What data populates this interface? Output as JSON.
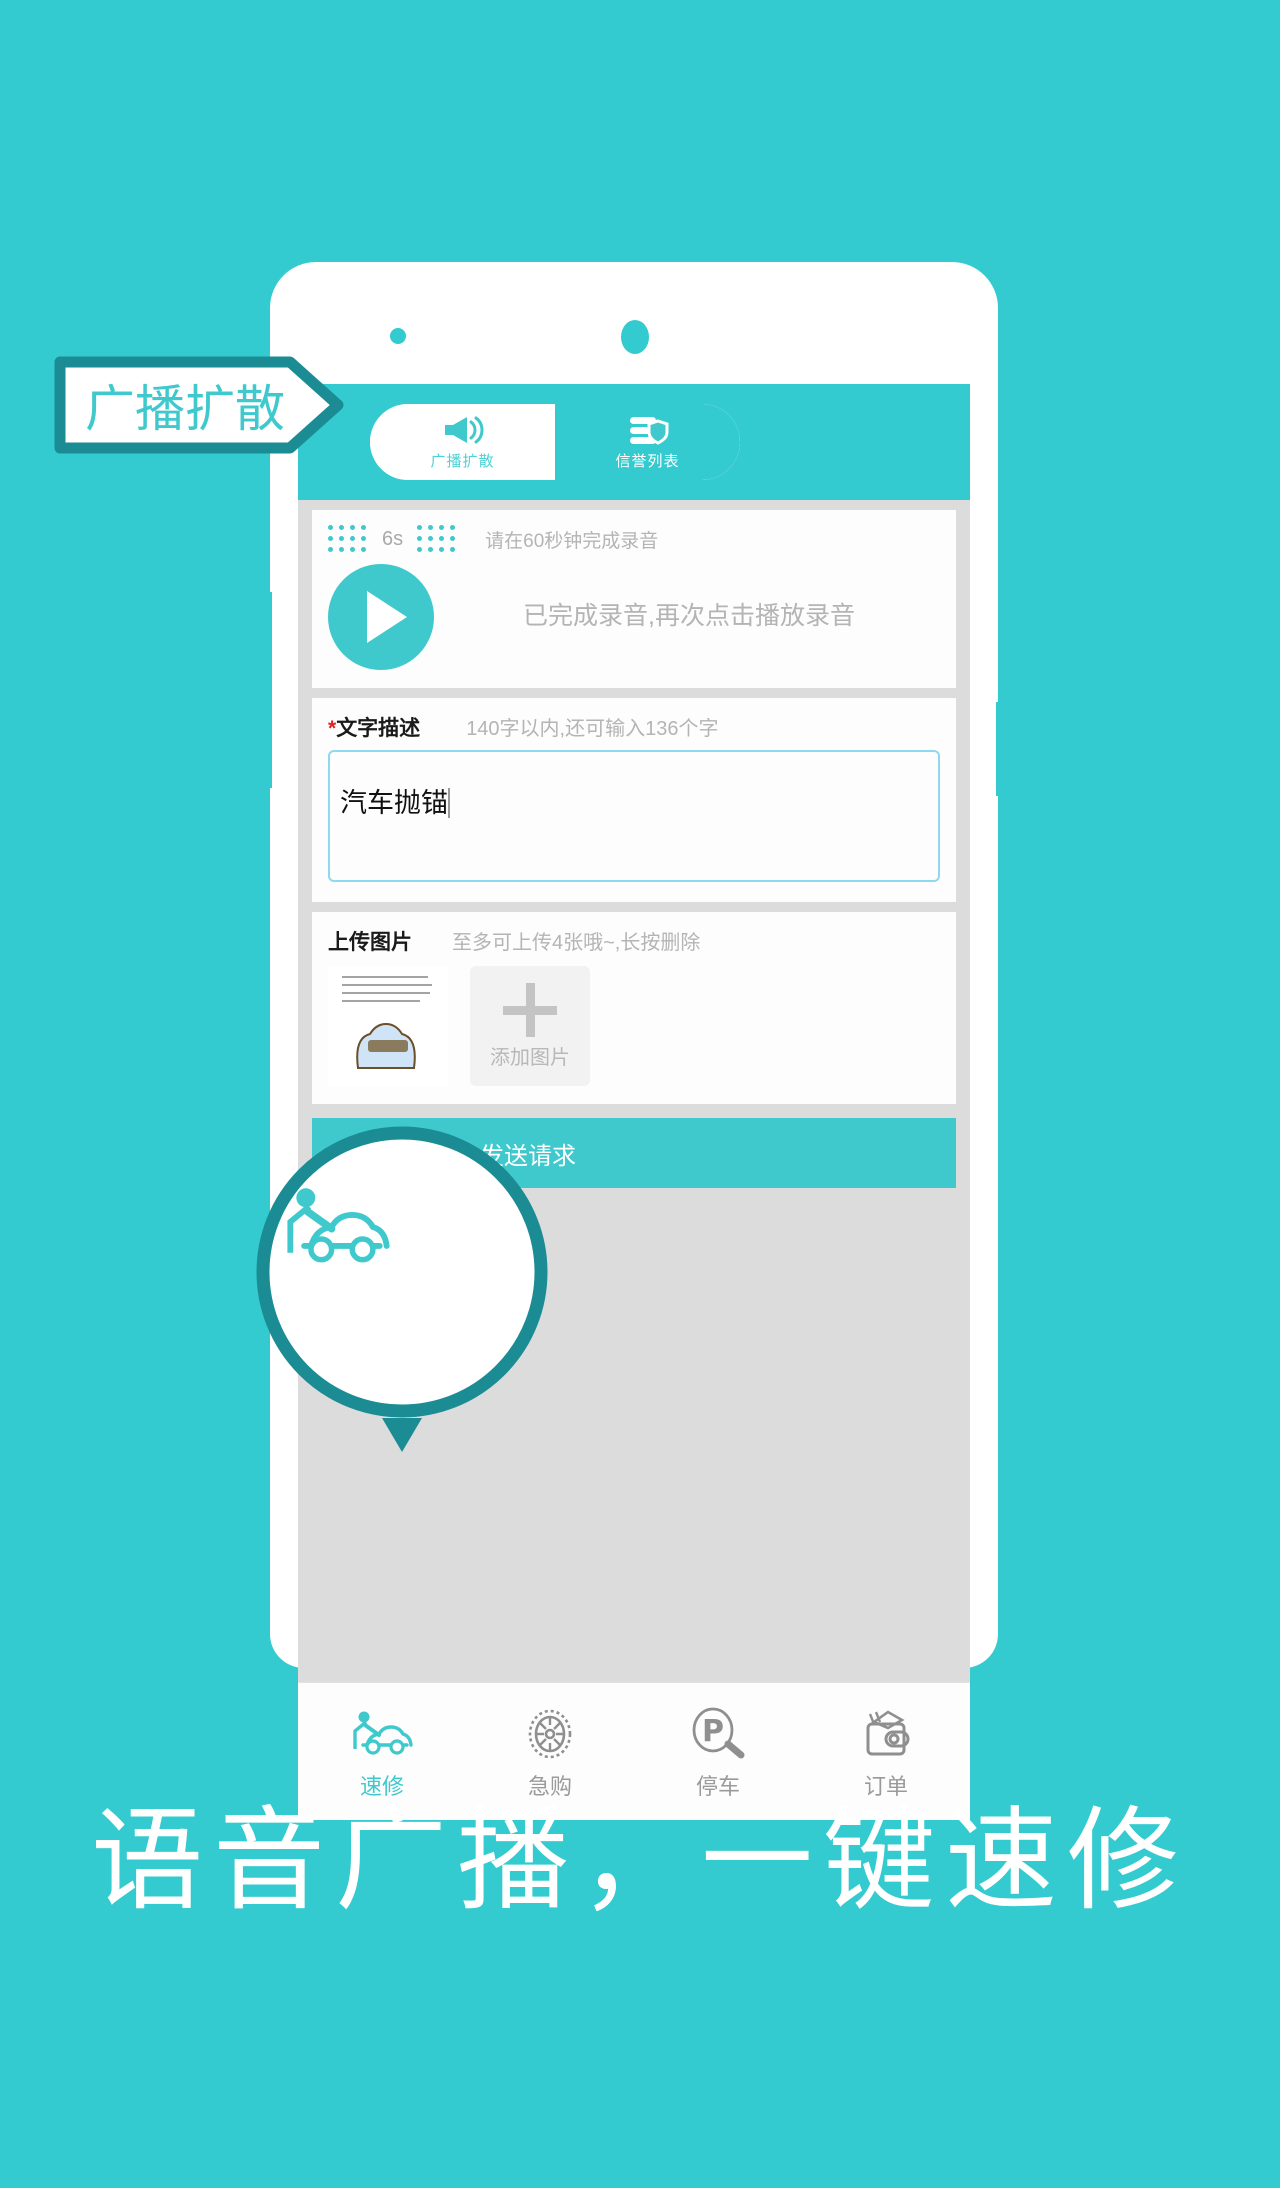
{
  "theme": {
    "background": "#33cbcf",
    "accent": "#3fc9cd",
    "accent_dark": "#1b8c93",
    "screen_bg": "#dcdcdc",
    "card_bg": "#fdfdfd",
    "muted_text": "#b4b4b4",
    "required_star": "#e02020"
  },
  "callout": {
    "label": "广播扩散"
  },
  "appbar": {
    "tabs": [
      {
        "label": "广播扩散",
        "icon": "megaphone-icon",
        "state": "active-white"
      },
      {
        "label": "信誉列表",
        "icon": "credit-list-icon",
        "state": "active-fill"
      }
    ]
  },
  "recording": {
    "seconds_label": "6s",
    "hint": "请在60秒钟完成录音",
    "status": "已完成录音,再次点击播放录音",
    "play_icon": "play-icon"
  },
  "description": {
    "required_marker": "*",
    "title": "文字描述",
    "counter": "140字以内,还可输入136个字",
    "value": "汽车抛锚",
    "placeholder": ""
  },
  "upload": {
    "title": "上传图片",
    "hint": "至多可上传4张哦~,长按删除",
    "add_label": "添加图片",
    "add_icon": "plus-icon"
  },
  "actions": {
    "send_label": "发送请求"
  },
  "bottom_nav": {
    "items": [
      {
        "label": "速修",
        "icon": "car-repair-icon",
        "active": true
      },
      {
        "label": "急购",
        "icon": "tire-icon",
        "active": false
      },
      {
        "label": "停车",
        "icon": "parking-search-icon",
        "active": false
      },
      {
        "label": "订单",
        "icon": "wallet-icon",
        "active": false
      }
    ]
  },
  "bubble": {
    "icon": "car-repair-icon"
  },
  "tagline": {
    "text": "语音广播，一键速修"
  }
}
